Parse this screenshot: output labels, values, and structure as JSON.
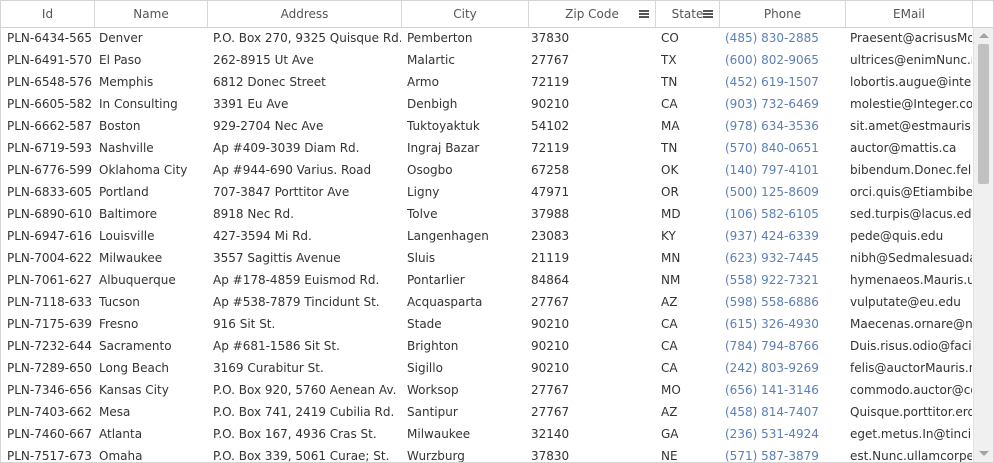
{
  "columns": [
    {
      "label": "Id",
      "has_menu": false
    },
    {
      "label": "Name",
      "has_menu": false
    },
    {
      "label": "Address",
      "has_menu": false
    },
    {
      "label": "City",
      "has_menu": false
    },
    {
      "label": "Zip Code",
      "has_menu": true
    },
    {
      "label": "State",
      "has_menu": true
    },
    {
      "label": "Phone",
      "has_menu": false
    },
    {
      "label": "EMail",
      "has_menu": false
    }
  ],
  "menu_icon": "hamburger-menu-icon",
  "phone_color": "#5a7fb8",
  "rows": [
    [
      "PLN-6434-565",
      "Denver",
      "P.O. Box 270, 9325 Quisque Rd.",
      "Pemberton",
      "37830",
      "CO",
      "(485) 830-2885",
      "Praesent@acrisusMo"
    ],
    [
      "PLN-6491-570",
      "El Paso",
      "262-8915 Ut Ave",
      "Malartic",
      "27767",
      "TX",
      "(600) 802-9065",
      "ultrices@enimNunc.n"
    ],
    [
      "PLN-6548-576",
      "Memphis",
      "6812 Donec Street",
      "Armo",
      "72119",
      "TN",
      "(452) 619-1507",
      "lobortis.augue@inter"
    ],
    [
      "PLN-6605-582",
      "In Consulting",
      "3391 Eu Ave",
      "Denbigh",
      "90210",
      "CA",
      "(903) 732-6469",
      "molestie@Integer.co"
    ],
    [
      "PLN-6662-587",
      "Boston",
      "929-2704 Nec Ave",
      "Tuktoyaktuk",
      "54102",
      "MA",
      "(978) 634-3536",
      "sit.amet@estmauris"
    ],
    [
      "PLN-6719-593",
      "Nashville",
      "Ap #409-3039 Diam Rd.",
      "Ingraj Bazar",
      "72119",
      "TN",
      "(570) 840-0651",
      "auctor@mattis.ca"
    ],
    [
      "PLN-6776-599",
      "Oklahoma City",
      "Ap #944-690 Varius. Road",
      "Osogbo",
      "67258",
      "OK",
      "(140) 797-4101",
      "bibendum.Donec.feli"
    ],
    [
      "PLN-6833-605",
      "Portland",
      "707-3847 Porttitor Ave",
      "Ligny",
      "47971",
      "OR",
      "(500) 125-8609",
      "orci.quis@Etiambiben"
    ],
    [
      "PLN-6890-610",
      "Baltimore",
      "8918 Nec Rd.",
      "Tolve",
      "37988",
      "MD",
      "(106) 582-6105",
      "sed.turpis@lacus.edu"
    ],
    [
      "PLN-6947-616",
      "Louisville",
      "427-3594 Mi Rd.",
      "Langenhagen",
      "23083",
      "KY",
      "(937) 424-6339",
      "pede@quis.edu"
    ],
    [
      "PLN-7004-622",
      "Milwaukee",
      "3557 Sagittis Avenue",
      "Sluis",
      "21119",
      "MN",
      "(623) 932-7445",
      "nibh@Sedmalesuada"
    ],
    [
      "PLN-7061-627",
      "Albuquerque",
      "Ap #178-4859 Euismod Rd.",
      "Pontarlier",
      "84864",
      "NM",
      "(558) 922-7321",
      "hymenaeos.Mauris.u"
    ],
    [
      "PLN-7118-633",
      "Tucson",
      "Ap #538-7879 Tincidunt St.",
      "Acquasparta",
      "27767",
      "AZ",
      "(598) 558-6886",
      "vulputate@eu.edu"
    ],
    [
      "PLN-7175-639",
      "Fresno",
      "916 Sit St.",
      "Stade",
      "90210",
      "CA",
      "(615) 326-4930",
      "Maecenas.ornare@n"
    ],
    [
      "PLN-7232-644",
      "Sacramento",
      "Ap #681-1586 Sit St.",
      "Brighton",
      "90210",
      "CA",
      "(784) 794-8766",
      "Duis.risus.odio@facil"
    ],
    [
      "PLN-7289-650",
      "Long Beach",
      "3169 Curabitur St.",
      "Sigillo",
      "90210",
      "CA",
      "(242) 803-9269",
      "felis@auctorMauris.n"
    ],
    [
      "PLN-7346-656",
      "Kansas City",
      "P.O. Box 920, 5760 Aenean Av.",
      "Worksop",
      "27767",
      "MO",
      "(656) 141-3146",
      "commodo.auctor@co"
    ],
    [
      "PLN-7403-662",
      "Mesa",
      "P.O. Box 741, 2419 Cubilia Rd.",
      "Santipur",
      "27767",
      "AZ",
      "(458) 814-7407",
      "Quisque.porttitor.ero"
    ],
    [
      "PLN-7460-667",
      "Atlanta",
      "P.O. Box 167, 4936 Cras St.",
      "Milwaukee",
      "32140",
      "GA",
      "(236) 531-4924",
      "eget.metus.In@tinci"
    ],
    [
      "PLN-7517-673",
      "Omaha",
      "P.O. Box 339, 5061 Curae; St.",
      "Wurzburg",
      "37830",
      "NE",
      "(571) 587-3879",
      "est.Nunc.ullamcorpe"
    ]
  ]
}
